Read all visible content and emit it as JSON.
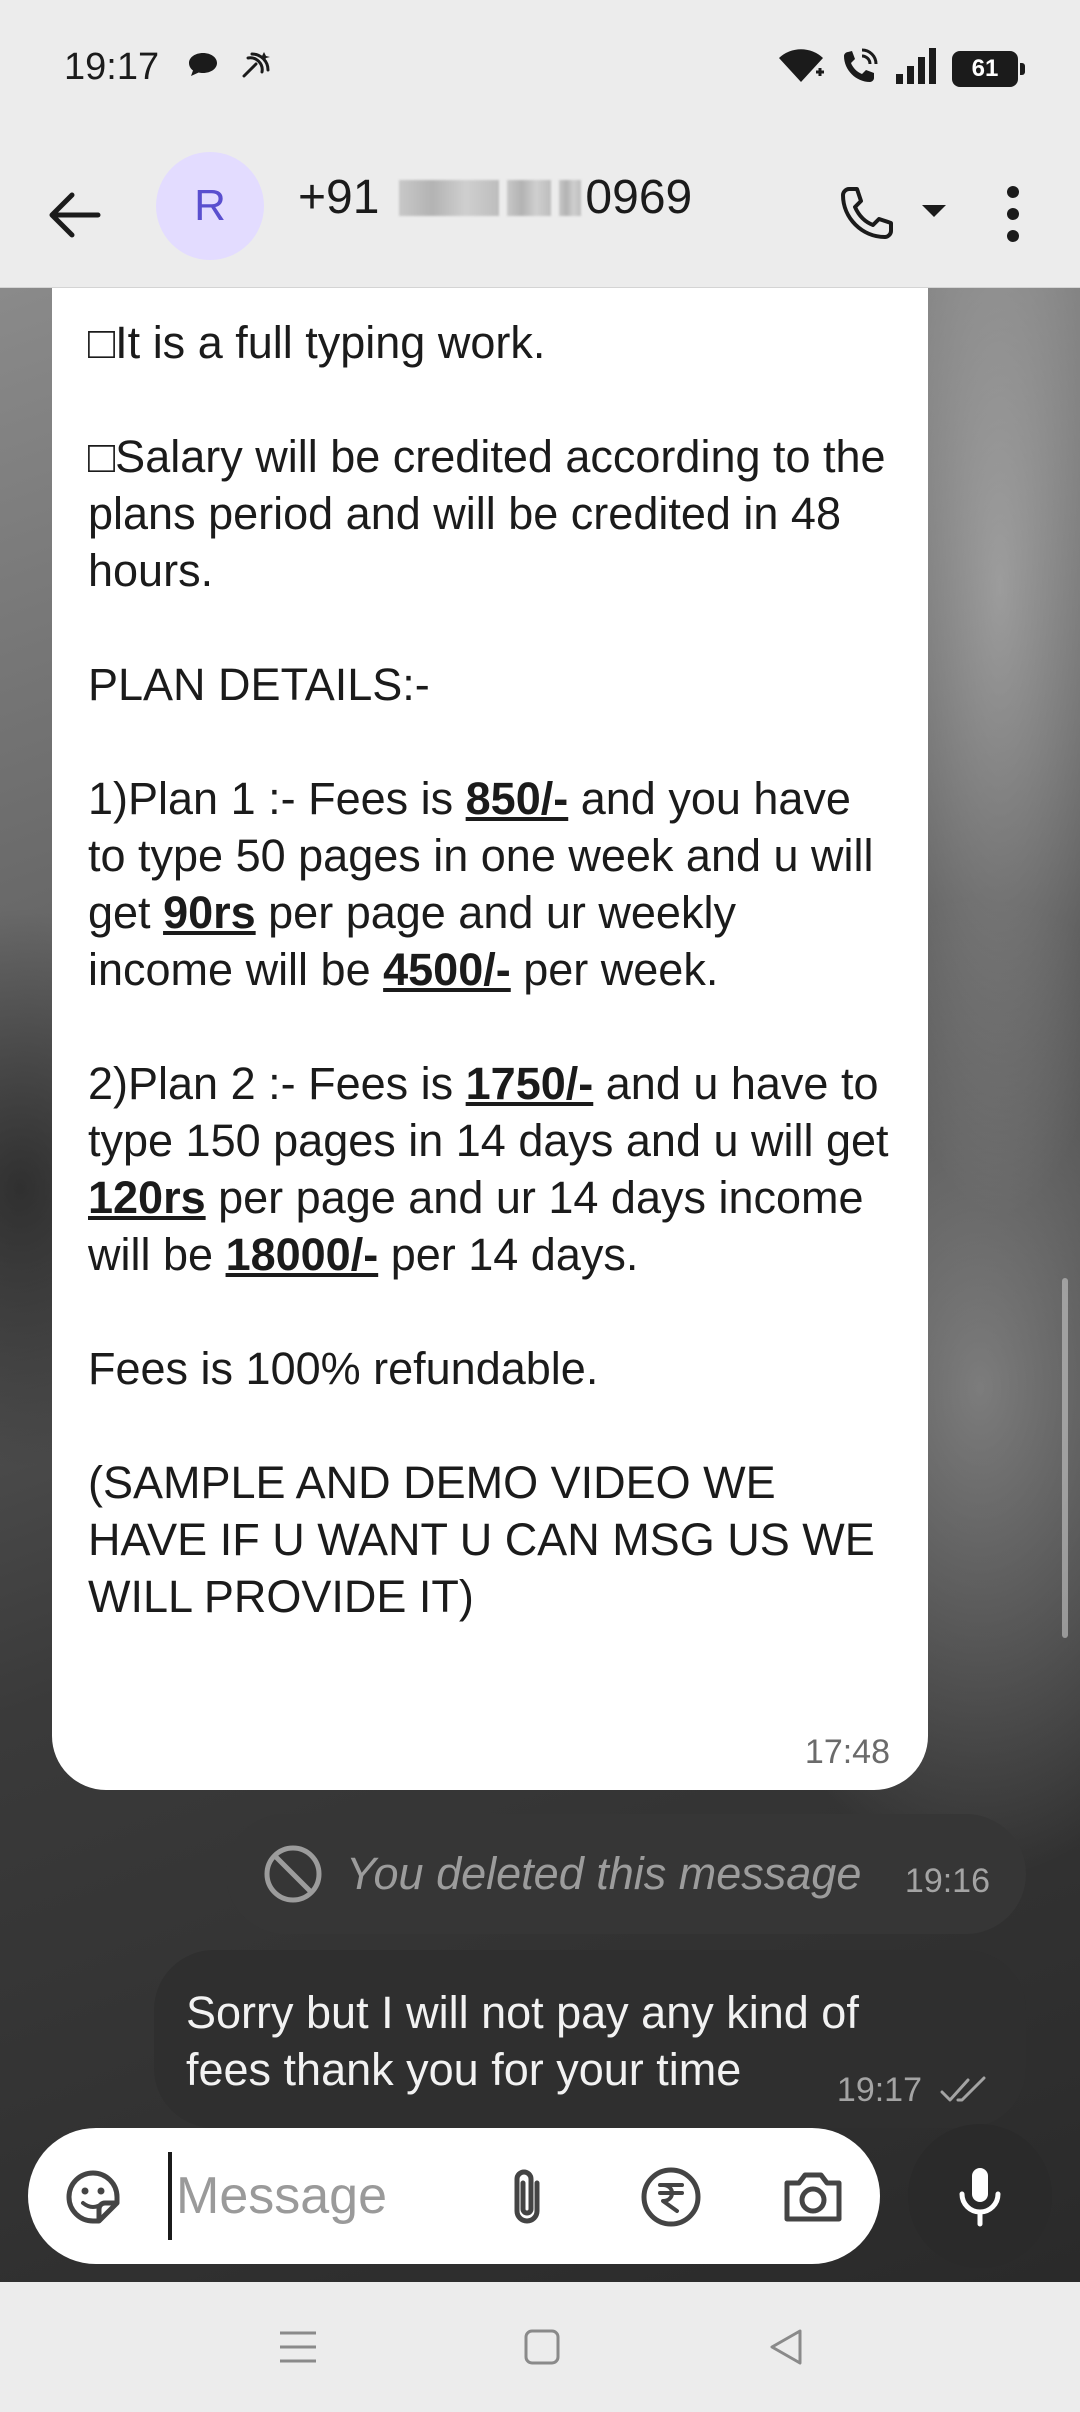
{
  "status_bar": {
    "time": "19:17",
    "battery": "61",
    "icons": [
      "chat-notification-icon",
      "signal-scan-icon",
      "wifi-icon",
      "wifi-calling-icon",
      "cellular-signal-icon",
      "battery-icon"
    ]
  },
  "header": {
    "avatar_letter": "R",
    "contact_prefix": "+91",
    "contact_suffix": "0969",
    "avatar_color": "#e3dcff",
    "avatar_text_color": "#5a4fcf"
  },
  "messages": {
    "incoming": {
      "para1": "□It is a full typing work.",
      "para2": "□Salary will be credited according to the plans period and will be credited in 48 hours.",
      "para3": "PLAN DETAILS:-",
      "plan1": {
        "t1": "1)Plan 1 :- Fees is ",
        "fee": "850/-",
        "t2": " and you have to type 50 pages in one week and u will get ",
        "rate": "90rs",
        "t3": " per page and ur weekly income will be ",
        "income": "4500/-",
        "t4": " per week."
      },
      "plan2": {
        "t1": "2)Plan 2 :- Fees is ",
        "fee": "1750/-",
        "t2": " and u have to type 150 pages in 14 days and u will get ",
        "rate": "120rs",
        "t3": " per page and ur 14 days income will be ",
        "income": "18000/-",
        "t4": " per 14 days."
      },
      "para4": "Fees is 100% refundable.",
      "para5": "(SAMPLE AND DEMO VIDEO WE HAVE IF U WANT U CAN MSG US WE WILL PROVIDE IT)",
      "time": "17:48"
    },
    "deleted": {
      "text": "You deleted this message",
      "time": "19:16"
    },
    "outgoing": {
      "text": "Sorry but I will not pay any kind of fees thank you for your time",
      "time": "19:17"
    }
  },
  "composer": {
    "placeholder": "Message"
  },
  "nav": {
    "icons": [
      "menu-icon",
      "home-icon",
      "back-triangle-icon"
    ]
  }
}
